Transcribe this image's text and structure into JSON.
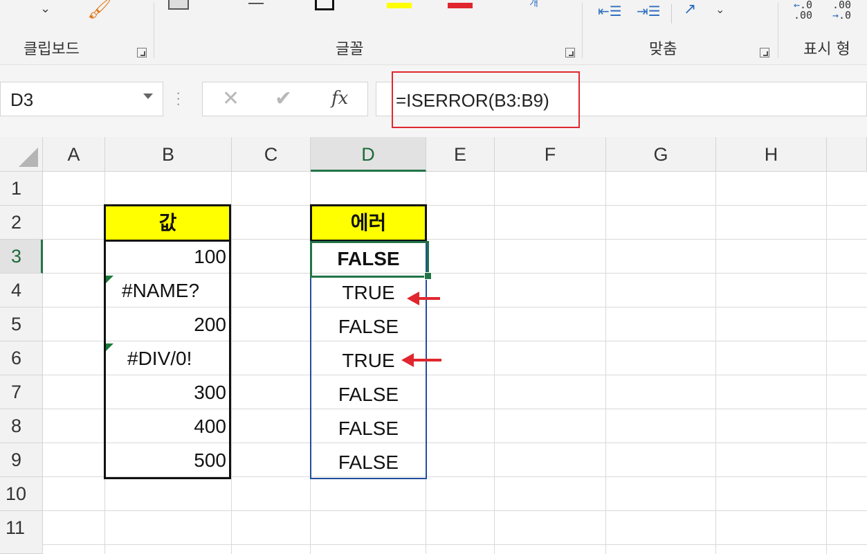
{
  "ribbon": {
    "groups": [
      {
        "label": "클립보드"
      },
      {
        "label": "글꼴"
      },
      {
        "label": "맞춤"
      },
      {
        "label": "표시 형"
      }
    ],
    "number_icons": {
      "inc_decimal": "←.0\n.00",
      "dec_decimal": ".00\n→.0"
    },
    "colors": {
      "highlight_yellow": "#ffff00",
      "font_red": "#e0262e",
      "excel_green": "#217346"
    }
  },
  "formula_bar": {
    "name_box": "D3",
    "cancel_icon": "✕",
    "enter_icon": "✔",
    "fx_label": "fx",
    "formula": "=ISERROR(B3:B9)"
  },
  "grid": {
    "columns": [
      "A",
      "B",
      "C",
      "D",
      "E",
      "F",
      "G",
      "H"
    ],
    "rows": [
      "1",
      "2",
      "3",
      "4",
      "5",
      "6",
      "7",
      "8",
      "9",
      "10",
      "11"
    ],
    "active_cell": "D3",
    "headers": {
      "B": "값",
      "D": "에러"
    },
    "values_B": [
      "100",
      "#NAME?",
      "200",
      "#DIV/0!",
      "300",
      "400",
      "500"
    ],
    "values_D": [
      "FALSE",
      "TRUE",
      "FALSE",
      "TRUE",
      "FALSE",
      "FALSE",
      "FALSE"
    ]
  }
}
